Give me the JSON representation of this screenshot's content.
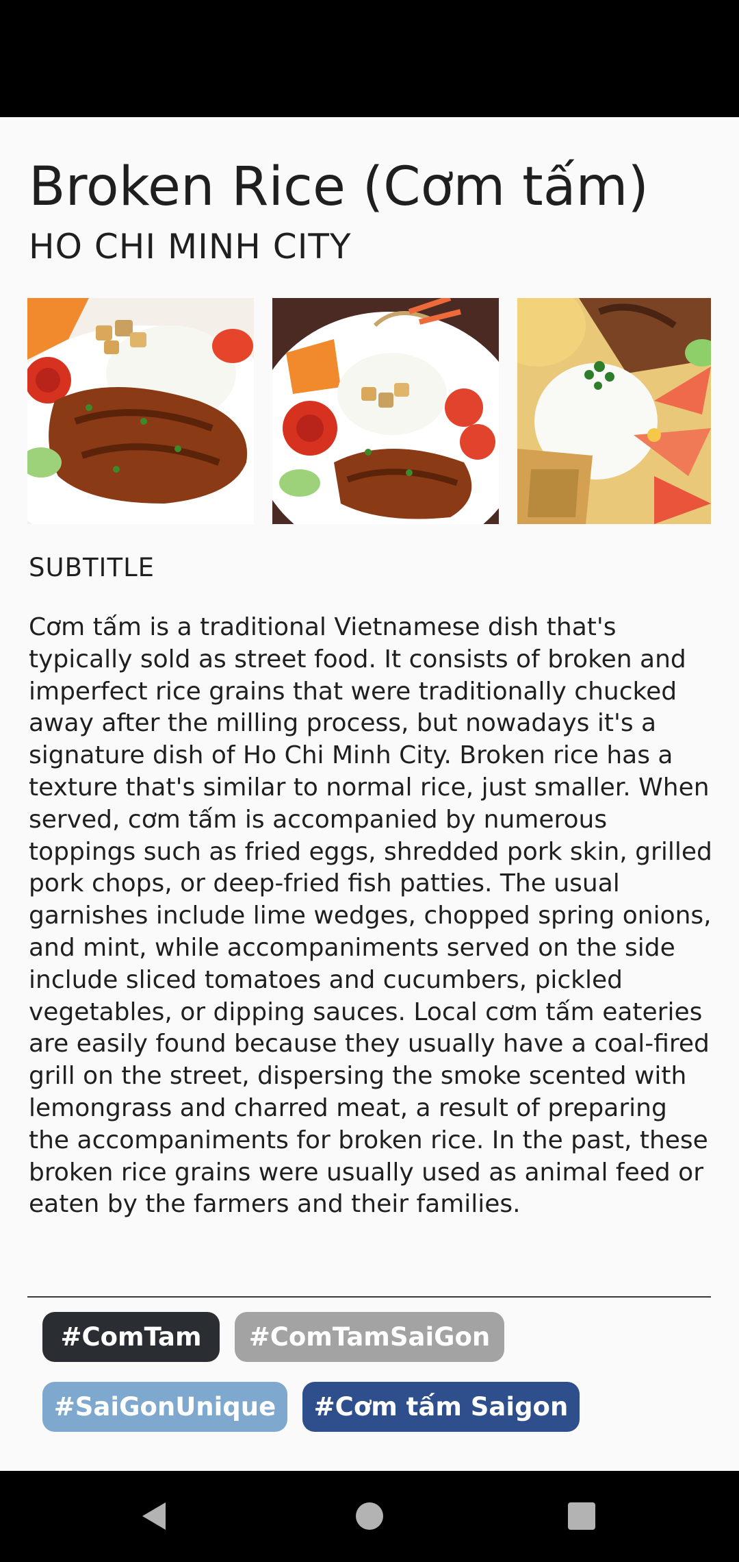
{
  "header": {
    "title": "Broken Rice (Cơm tấm)",
    "location": "HO CHI MINH CITY"
  },
  "gallery": {
    "photos": [
      {
        "description": "food-photo"
      },
      {
        "description": "food-photo"
      },
      {
        "description": "food-photo"
      }
    ]
  },
  "subtitle": "SUBTITLE",
  "description": "Cơm tấm is a traditional Vietnamese dish that's typically sold as street food. It consists of broken and imperfect rice grains that were traditionally chucked away after the milling process, but nowadays it's a signature dish of Ho Chi Minh City.  Broken rice has a texture that's similar to normal rice, just smaller. When served, cơm tấm is accompanied by numerous toppings such as fried eggs, shredded pork skin, grilled pork chops, or deep-fried fish patties. The usual garnishes include lime wedges, chopped spring onions, and mint, while accompaniments served on the side include sliced tomatoes and cucumbers, pickled vegetables, or dipping sauces.  Local cơm tấm eateries are easily found because they usually have a coal-fired grill on the street, dispersing the smoke scented with lemongrass and charred meat, a result of preparing the accompaniments for broken rice. In the past, these broken rice grains were usually used as animal feed or eaten by the farmers and their families.",
  "tags": [
    {
      "label": "#ComTam",
      "color": "#2a2e33"
    },
    {
      "label": "#ComTamSaiGon",
      "color": "#a3a3a3"
    },
    {
      "label": "#SaiGonUnique",
      "color": "#7fa8cf"
    },
    {
      "label": "#Cơm tấm Saigon",
      "color": "#2f4f8c"
    }
  ],
  "nav": {
    "back_icon": "back-triangle-icon",
    "home_icon": "home-circle-icon",
    "recents_icon": "recents-square-icon"
  },
  "colors": {
    "status_bar": "#000000",
    "background": "#fafafa",
    "text": "#1f1f1f"
  }
}
